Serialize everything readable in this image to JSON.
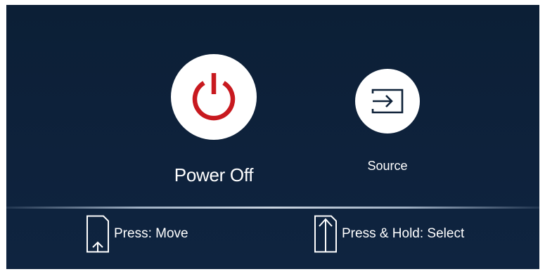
{
  "menu": {
    "options": [
      {
        "label": "Power Off",
        "icon": "power-icon",
        "icon_color": "#c8191f"
      },
      {
        "label": "Source",
        "icon": "source-input-icon",
        "icon_color": "#0e2138"
      }
    ]
  },
  "hints": {
    "move": {
      "label": "Press: Move",
      "icon": "press-button-icon"
    },
    "select": {
      "label": "Press & Hold: Select",
      "icon": "press-hold-icon"
    }
  },
  "colors": {
    "background": "#0e2138",
    "accent": "#c8191f"
  }
}
